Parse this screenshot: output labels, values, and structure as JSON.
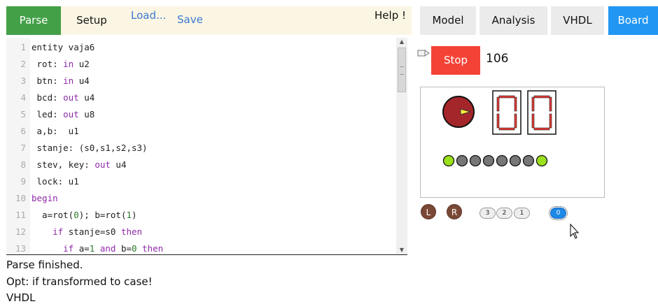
{
  "toolbar": {
    "parse": "Parse",
    "setup": "Setup",
    "load": "Load...",
    "save": "Save",
    "help": "Help !"
  },
  "editor": {
    "lines": [
      {
        "n": "1",
        "segs": [
          {
            "t": "entity vaja6"
          }
        ]
      },
      {
        "n": "2",
        "segs": [
          {
            "t": " rot: "
          },
          {
            "t": "in",
            "c": "kw"
          },
          {
            "t": " u2"
          }
        ]
      },
      {
        "n": "3",
        "segs": [
          {
            "t": " btn: "
          },
          {
            "t": "in",
            "c": "kw"
          },
          {
            "t": " u4"
          }
        ]
      },
      {
        "n": "4",
        "segs": [
          {
            "t": " bcd: "
          },
          {
            "t": "out",
            "c": "kw"
          },
          {
            "t": " u4"
          }
        ]
      },
      {
        "n": "5",
        "segs": [
          {
            "t": " led: "
          },
          {
            "t": "out",
            "c": "kw"
          },
          {
            "t": " u8"
          }
        ]
      },
      {
        "n": "6",
        "segs": [
          {
            "t": " a,b:  u1"
          }
        ]
      },
      {
        "n": "7",
        "segs": [
          {
            "t": " stanje: (s0,s1,s2,s3)"
          }
        ]
      },
      {
        "n": "8",
        "segs": [
          {
            "t": " stev, key: "
          },
          {
            "t": "out",
            "c": "kw"
          },
          {
            "t": " u4"
          }
        ]
      },
      {
        "n": "9",
        "segs": [
          {
            "t": " lock: u1"
          }
        ]
      },
      {
        "n": "10",
        "segs": [
          {
            "t": "begin",
            "c": "kw"
          }
        ]
      },
      {
        "n": "11",
        "segs": [
          {
            "t": "  a=rot("
          },
          {
            "t": "0",
            "c": "num"
          },
          {
            "t": "); b=rot("
          },
          {
            "t": "1",
            "c": "num"
          },
          {
            "t": ")"
          }
        ]
      },
      {
        "n": "12",
        "segs": [
          {
            "t": "    "
          },
          {
            "t": "if",
            "c": "kw"
          },
          {
            "t": " stanje=s0 "
          },
          {
            "t": "then",
            "c": "kw"
          }
        ]
      },
      {
        "n": "13",
        "segs": [
          {
            "t": "      "
          },
          {
            "t": "if",
            "c": "kw"
          },
          {
            "t": " a="
          },
          {
            "t": "1",
            "c": "num"
          },
          {
            "t": " "
          },
          {
            "t": "and",
            "c": "kw"
          },
          {
            "t": " b="
          },
          {
            "t": "0",
            "c": "num"
          },
          {
            "t": " "
          },
          {
            "t": "then",
            "c": "kw"
          }
        ]
      }
    ]
  },
  "messages": [
    "Parse finished.",
    "Opt: if transformed to case!",
    "VHDL"
  ],
  "tabs": {
    "model": "Model",
    "analysis": "Analysis",
    "vhdl": "VHDL",
    "board": "Board",
    "active": "Board",
    "active_color": "#2196f3"
  },
  "sim": {
    "stop": "Stop",
    "counter": "106",
    "stop_color": "#f44336"
  },
  "board": {
    "knob_color": "#a5262a",
    "segment_color": "#e53935",
    "digits": [
      "0",
      "0"
    ],
    "leds": [
      true,
      false,
      false,
      false,
      false,
      false,
      false,
      true
    ],
    "led_on_color": "#9be01c",
    "led_off_color": "#777777"
  },
  "controls": {
    "left": "L",
    "right": "R",
    "switches": [
      "3",
      "2",
      "1",
      "0"
    ],
    "switch_on": "0",
    "button_color": "#7a4836"
  }
}
